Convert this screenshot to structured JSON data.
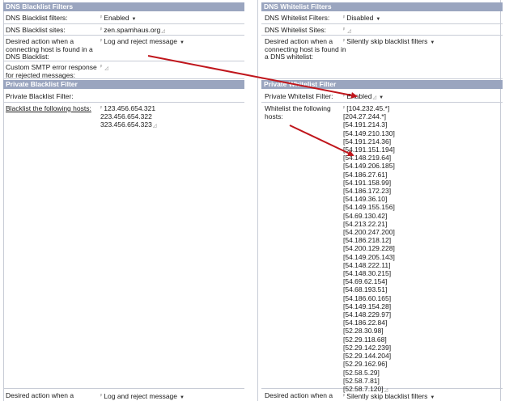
{
  "dns_blacklist": {
    "header": "DNS Blacklist Filters",
    "filters_label": "DNS Blacklist filters:",
    "filters_value": "Enabled",
    "sites_label": "DNS Blacklist sites:",
    "sites_value": "zen.spamhaus.org",
    "action_label_1": "Desired action when a",
    "action_label_2": "connecting host is found in a",
    "action_label_3": "DNS Blacklist:",
    "action_value": "Log and reject message",
    "smtp_label_1": "Custom SMTP error response",
    "smtp_label_2": "for rejected messages:"
  },
  "dns_whitelist": {
    "header": "DNS Whitelist Filters",
    "filters_label": "DNS Whitelist Filters:",
    "filters_value": "Disabled",
    "sites_label": "DNS Whitelist Sites:",
    "action_label_1": "Desired action when a",
    "action_label_2": "connecting host is found in",
    "action_label_3": "a DNS whitelist:",
    "action_value": "Silently skip blacklist filters"
  },
  "private_blacklist": {
    "header": "Private Blacklist Filter",
    "filter_label": "Private Blacklist Filter:",
    "filter_value": "Enabled",
    "hosts_label": "Blacklist the following hosts:",
    "hosts": [
      "123.456.654.321",
      "223.456.654.322",
      "323.456.654.323"
    ]
  },
  "private_whitelist": {
    "header": "Private Whitelist Filter",
    "filter_label": "Private Whitelist Filter:",
    "filter_value": "Enabled",
    "hosts_label_1": "Whitelist the following",
    "hosts_label_2": "hosts:",
    "hosts": [
      "[104.232.45.*]",
      "[204.27.244.*]",
      "[54.191.214.3]",
      "[54.149.210.130]",
      "[54.191.214.36]",
      "[54.191.151.194]",
      "[54.148.219.64]",
      "[54.149.206.185]",
      "[54.186.27.61]",
      "[54.191.158.99]",
      "[54.186.172.23]",
      "[54.149.36.10]",
      "[54.149.155.156]",
      "[54.69.130.42]",
      "[54.213.22.21]",
      "[54.200.247.200]",
      "[54.186.218.12]",
      "[54.200.129.228]",
      "[54.149.205.143]",
      "[54.148.222.11]",
      "[54.148.30.215]",
      "[54.69.62.154]",
      "[54.68.193.51]",
      "[54.186.60.165]",
      "[54.149.154.28]",
      "[54.148.229.97]",
      "[54.186.22.84]",
      "[52.28.30.98]",
      "[52.29.118.68]",
      "[52.29.142.239]",
      "[52.29.144.204]",
      "[52.29.162.96]",
      "[52.58.5.29]",
      "[52.58.7.81]",
      "[52.58.7.120]"
    ]
  },
  "bottom": {
    "left_label": "Desired action when a",
    "left_value": "Log and reject message",
    "right_label": "Desired action when a",
    "right_value": "Silently skip blacklist filters"
  },
  "colors": {
    "header_bg": "#9aa5bf",
    "arrow": "#c0161c",
    "row_border": "#c8ccd6"
  },
  "icons": {
    "dropdown": "dropdown-arrow-icon",
    "field_marker": "field-marker-icon"
  }
}
